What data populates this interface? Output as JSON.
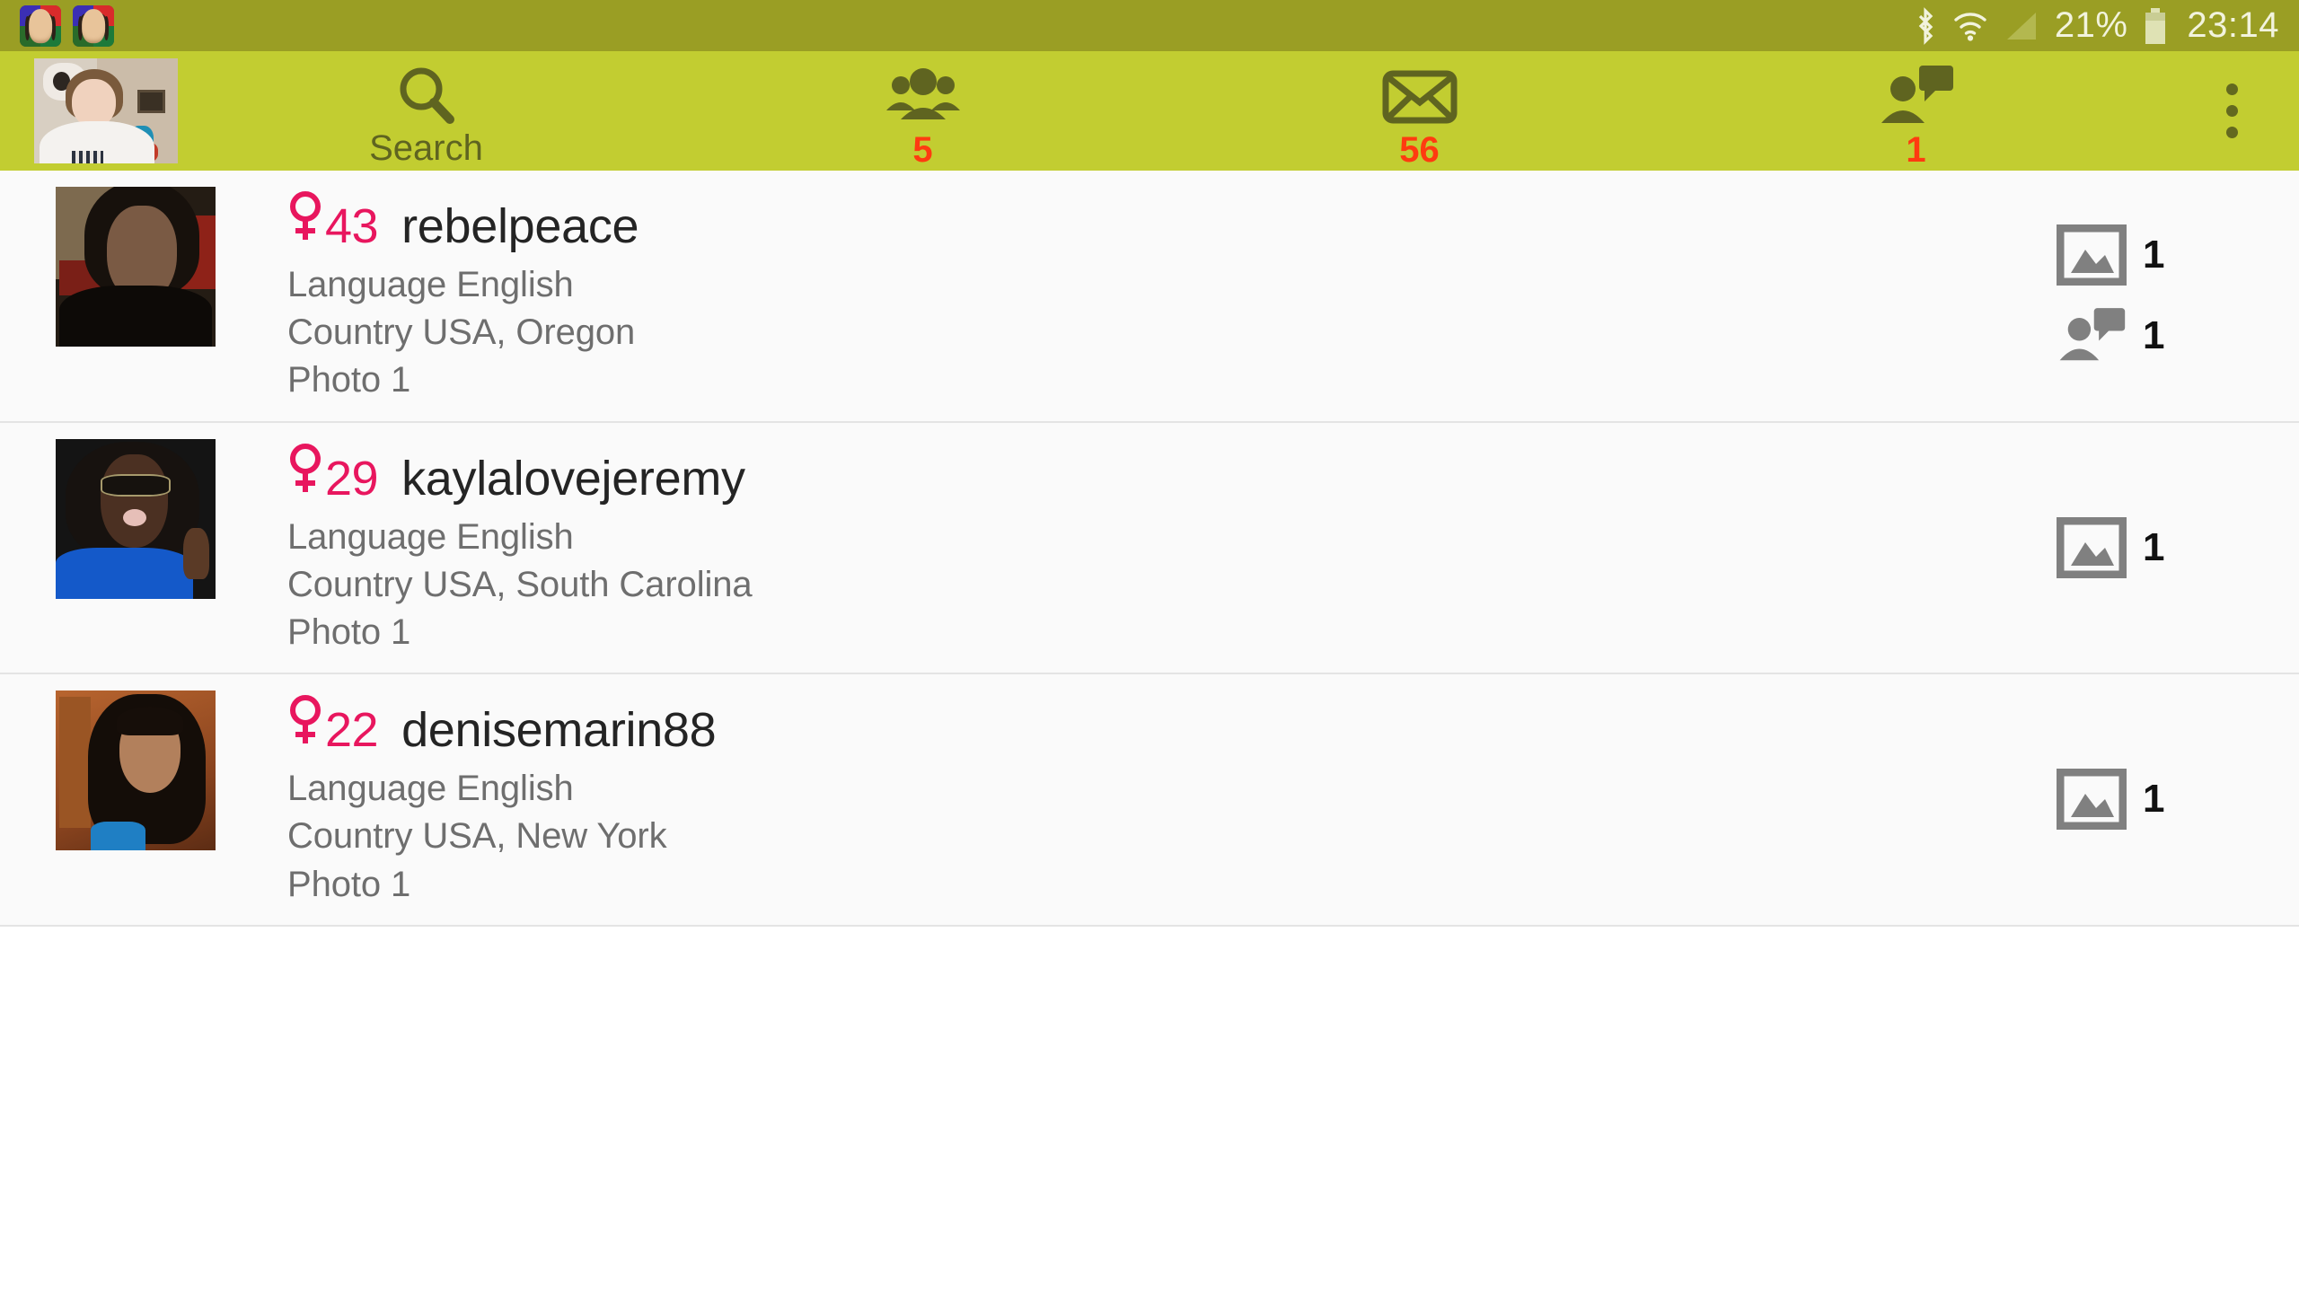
{
  "status_bar": {
    "notification_icons": [
      "app-notification-avatar",
      "app-notification-avatar"
    ],
    "bluetooth_icon": "bluetooth-icon",
    "wifi_icon": "wifi-icon",
    "signal_icon": "cellular-signal-icon",
    "battery_percent": "21%",
    "battery_icon": "battery-icon",
    "clock": "23:14",
    "background_color": "#9a9e24",
    "text_color": "#f2f3dd"
  },
  "header": {
    "background_color": "#c2cd31",
    "icon_color": "#5f6420",
    "badge_color": "#ff3b10",
    "profile_avatar": "my-profile-avatar",
    "nav": [
      {
        "icon": "search-icon",
        "label": "Search",
        "badge": ""
      },
      {
        "icon": "friends-group-icon",
        "label": "",
        "badge": "5"
      },
      {
        "icon": "mail-envelope-icon",
        "label": "",
        "badge": "56"
      },
      {
        "icon": "visitor-chat-icon",
        "label": "",
        "badge": "1"
      }
    ],
    "overflow_menu": "overflow-menu-icon"
  },
  "list": {
    "gender_symbol": "female-venus-symbol",
    "age_color": "#e8165e",
    "rows": [
      {
        "avatar": "user-avatar-rebelpeace",
        "age": "43",
        "username": "rebelpeace",
        "language": "Language English",
        "country": "Country USA, Oregon",
        "photo": "Photo 1",
        "counters": [
          {
            "icon": "photo-icon",
            "count": "1"
          },
          {
            "icon": "visitor-chat-icon",
            "count": "1"
          }
        ]
      },
      {
        "avatar": "user-avatar-kaylalovejeremy",
        "age": "29",
        "username": "kaylalovejeremy",
        "language": "Language English",
        "country": "Country USA, South Carolina",
        "photo": "Photo 1",
        "counters": [
          {
            "icon": "photo-icon",
            "count": "1"
          }
        ]
      },
      {
        "avatar": "user-avatar-denisemarin88",
        "age": "22",
        "username": "denisemarin88",
        "language": "Language English",
        "country": "Country USA, New York",
        "photo": "Photo 1",
        "counters": [
          {
            "icon": "photo-icon",
            "count": "1"
          }
        ]
      }
    ]
  }
}
